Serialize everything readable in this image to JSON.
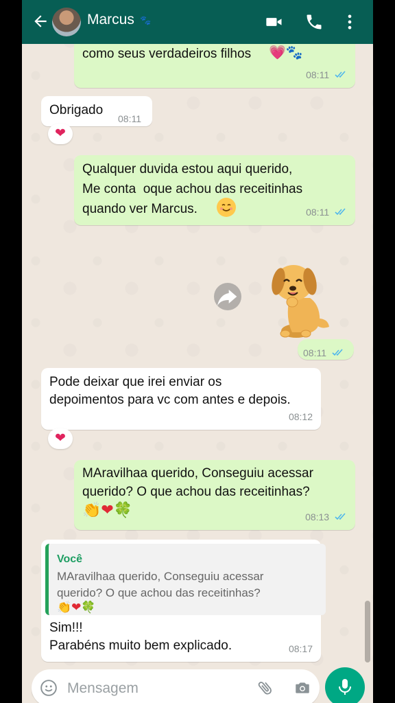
{
  "header": {
    "contact_name": "Marcus",
    "paw_emoji": "🐾"
  },
  "messages": [
    {
      "id": "m1",
      "direction": "outgoing",
      "text": "como seus verdadeiros filhos",
      "emoji": "💗🐾",
      "time": "08:11",
      "status": "read"
    },
    {
      "id": "m2",
      "direction": "incoming",
      "text": "Obrigado",
      "time": "08:11",
      "reaction": "❤"
    },
    {
      "id": "m3",
      "direction": "outgoing",
      "text": "Qualquer duvida estou aqui querido,\nMe conta  oque achou das receitinhas\nquando ver Marcus.",
      "emoji": "☺",
      "time": "08:11",
      "status": "read"
    },
    {
      "id": "m4",
      "direction": "outgoing",
      "type": "sticker",
      "sticker": "puppy-sticker",
      "time": "08:11",
      "status": "read"
    },
    {
      "id": "m5",
      "direction": "incoming",
      "text": "Pode deixar que irei enviar os\ndepoimentos para vc com antes e depois.",
      "time": "08:12",
      "reaction": "❤"
    },
    {
      "id": "m6",
      "direction": "outgoing",
      "text": "MAravilhaa querido, Conseguiu acessar\nquerido? O que achou das receitinhas?",
      "emoji": "👏❤🍀",
      "time": "08:13",
      "status": "read"
    },
    {
      "id": "m7",
      "direction": "incoming",
      "quote_author": "Você",
      "quote_text": "MAravilhaa querido, Conseguiu acessar\nquerido? O que achou das receitinhas?",
      "quote_emoji": "👏❤🍀",
      "text": "Sim!!!\nParabéns muito bem explicado.",
      "time": "08:17"
    }
  ],
  "composer": {
    "placeholder": "Mensagem"
  },
  "colors": {
    "header": "#075e54",
    "outgoing_bubble": "#dcf8c6",
    "incoming_bubble": "#ffffff",
    "read_ticks": "#4fb6ec",
    "mic_button": "#00a884",
    "chat_background": "#efe7de"
  }
}
